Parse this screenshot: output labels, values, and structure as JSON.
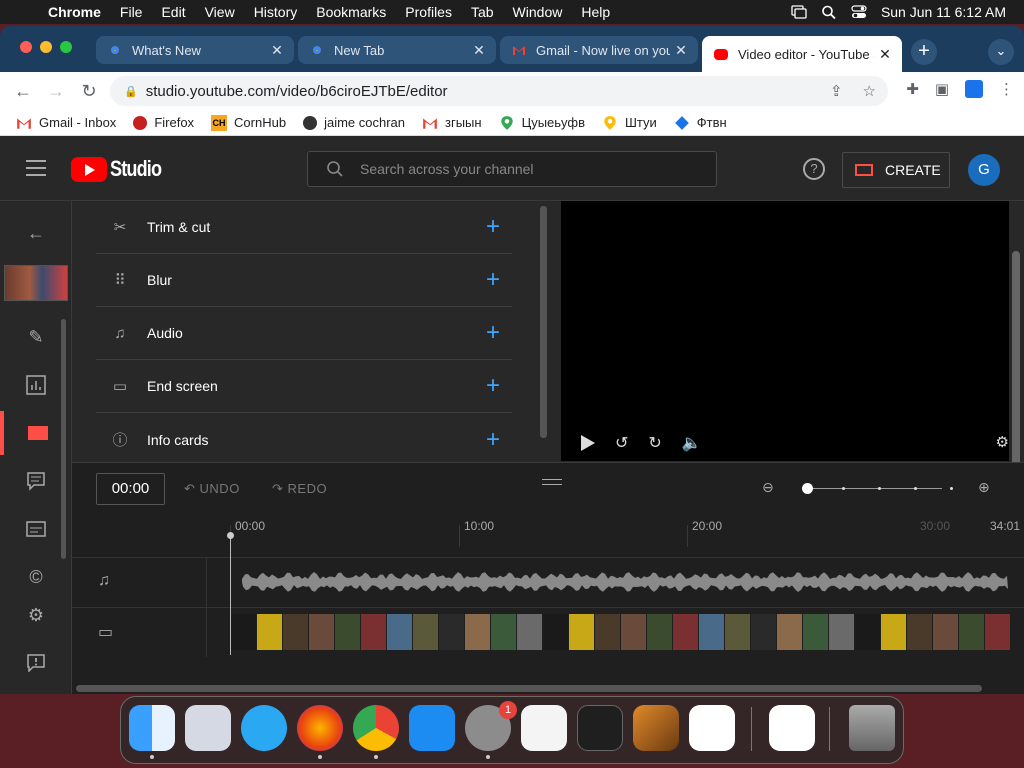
{
  "menubar": {
    "app": "Chrome",
    "items": [
      "File",
      "Edit",
      "View",
      "History",
      "Bookmarks",
      "Profiles",
      "Tab",
      "Window",
      "Help"
    ],
    "datetime": "Sun Jun 11  6:12 AM"
  },
  "tabs": [
    {
      "label": "What's New",
      "favicon": "chrome-icon"
    },
    {
      "label": "New Tab",
      "favicon": "chrome-icon"
    },
    {
      "label": "Gmail - Now live on your",
      "favicon": "gmail-icon"
    },
    {
      "label": "Video editor - YouTube S",
      "favicon": "youtube-icon"
    }
  ],
  "url": "studio.youtube.com/video/b6ciroEJTbE/editor",
  "bookmarks": [
    {
      "label": "Gmail - Inbox",
      "icon": "gmail-icon"
    },
    {
      "label": "Firefox",
      "icon": "firefox-icon"
    },
    {
      "label": "CornHub",
      "icon": "ch-icon"
    },
    {
      "label": "jaime cochran",
      "icon": "globe-icon"
    },
    {
      "label": "згыын",
      "icon": "gmail-icon"
    },
    {
      "label": "Цуыеьуфв",
      "icon": "maps-icon"
    },
    {
      "label": "Штуи",
      "icon": "maps-icon"
    },
    {
      "label": "Фтвн",
      "icon": "diamond-icon"
    }
  ],
  "studio": {
    "logo_text": "Studio",
    "search_placeholder": "Search across your channel",
    "create_label": "CREATE",
    "avatar_letter": "G"
  },
  "tools": [
    {
      "label": "Trim & cut",
      "icon": "scissors-icon"
    },
    {
      "label": "Blur",
      "icon": "blur-icon"
    },
    {
      "label": "Audio",
      "icon": "music-note-icon"
    },
    {
      "label": "End screen",
      "icon": "end-screen-icon"
    },
    {
      "label": "Info cards",
      "icon": "info-icon"
    }
  ],
  "timeline": {
    "time": "00:00",
    "undo": "UNDO",
    "redo": "REDO",
    "ticks": [
      "00:00",
      "10:00",
      "20:00"
    ],
    "ghost_tick": "30:00",
    "end": "34:01"
  },
  "dock": [
    "Finder",
    "Launchpad",
    "Safari",
    "Firefox",
    "Chrome",
    "App Store",
    "System Settings",
    "TextEdit",
    "Terminal",
    "GarageBand",
    "VS Code",
    "Visual Studio",
    "Trash"
  ],
  "dock_badge": "1",
  "colors": {
    "youtube_red": "#ff0000",
    "accent_blue": "#3ea6ff",
    "tabbar": "#1c3d5e"
  }
}
